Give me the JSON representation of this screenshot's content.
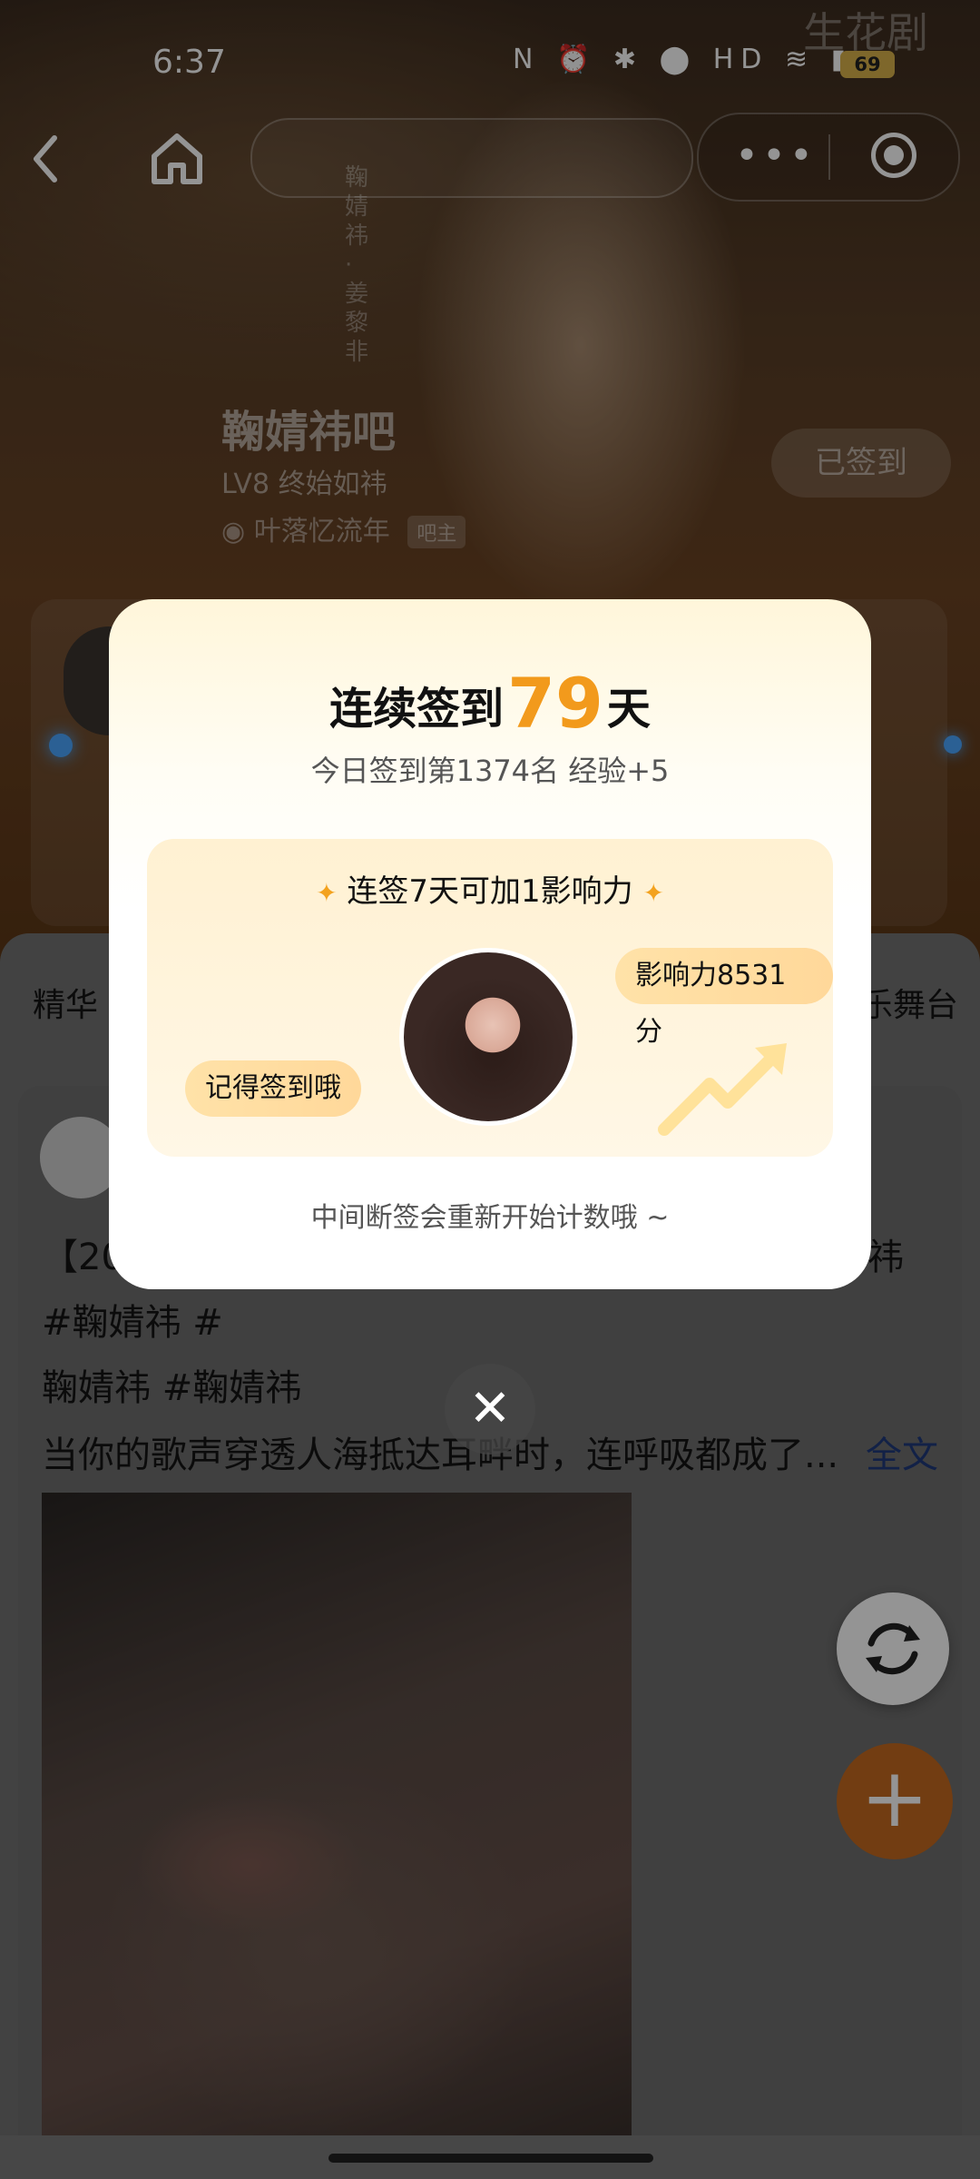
{
  "status_bar": {
    "time": "6:37",
    "icons": [
      "nfc-icon",
      "alarm-icon",
      "bluetooth-icon",
      "location-icon",
      "hd-icon",
      "wifi-icon",
      "4g-signal-icon"
    ],
    "battery": "69",
    "watermark": "生花剧"
  },
  "nav": {
    "search_placeholder": ""
  },
  "forum": {
    "name": "鞠婧祎吧",
    "level": "LV8 终始如祎",
    "owner": "叶落忆流年",
    "owner_badge": "吧主",
    "signed_label": "已签到",
    "poster_text": "鞠婧祎·姜黎非"
  },
  "tabs": {
    "left": "精华",
    "right": "乐舞台"
  },
  "post": {
    "line1_prefix": "【20",
    "line1_suffix": "祎",
    "line2": "#鞠婧祎 #",
    "line3": "鞠婧祎 #鞠婧祎",
    "line4": "当你的歌声穿透人海抵达耳畔时，连呼吸都成了...",
    "full_text": "全文"
  },
  "modal": {
    "title_prefix": "连续签到",
    "streak_days": "79",
    "title_suffix": "天",
    "subtitle": "今日签到第1374名 经验+5",
    "reward_title": "连签7天可加1影响力",
    "bubble_remind": "记得签到哦",
    "bubble_influence": "影响力8531分",
    "note": "中间断签会重新开始计数哦 ~"
  },
  "colors": {
    "accent_orange": "#f29a1c",
    "fab_orange": "#c46a1f"
  }
}
